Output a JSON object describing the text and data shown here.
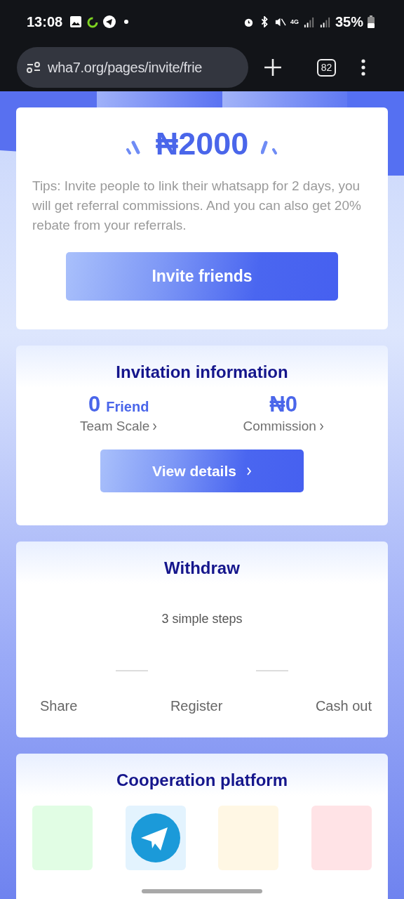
{
  "status_bar": {
    "time": "13:08",
    "network": "4G",
    "battery": "35%"
  },
  "address_bar": {
    "url": "wha7.org/pages/invite/frie",
    "tab_count": "82"
  },
  "reward_card": {
    "amount": "₦2000",
    "tips": "Tips: Invite people to link their whatsapp for 2 days, you will get referral commissions. And you can also get 20% rebate from your referrals.",
    "button": "Invite friends"
  },
  "invitation_card": {
    "title": "Invitation information",
    "stats": [
      {
        "value": "0",
        "unit": "Friend",
        "label": "Team Scale"
      },
      {
        "value": "₦0",
        "label": "Commission"
      }
    ],
    "button": "View details"
  },
  "withdraw_card": {
    "title": "Withdraw",
    "subtitle": "3 simple steps",
    "steps": [
      "Share",
      "Register",
      "Cash out"
    ]
  },
  "platform_card": {
    "title": "Cooperation platform",
    "tiles": [
      {
        "kind": "blank",
        "color": "#e1fde4"
      },
      {
        "kind": "telegram",
        "color": "#e3f3fe"
      },
      {
        "kind": "blank",
        "color": "#fff7e4"
      },
      {
        "kind": "blank",
        "color": "#ffe3e6"
      }
    ]
  }
}
